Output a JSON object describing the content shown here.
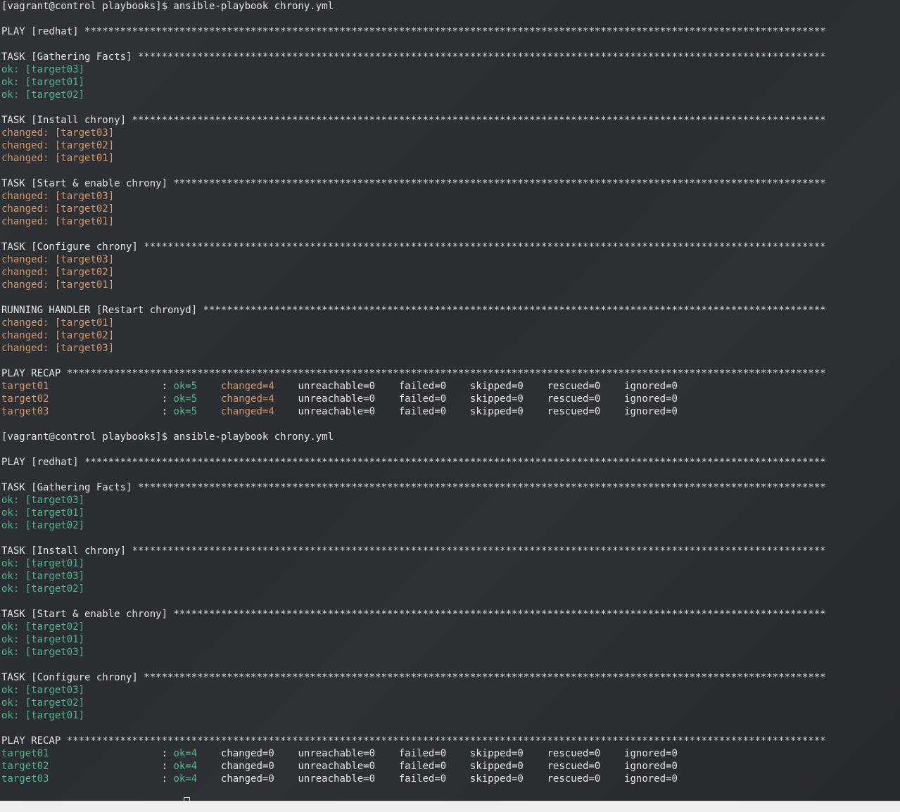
{
  "colors": {
    "background": "#2b2f33",
    "text": "#e4e6e8",
    "ok": "#53b88b",
    "changed": "#d6986b",
    "statusbar": "#efefef"
  },
  "terminal": {
    "lines": [
      [
        {
          "t": "[vagrant@control playbooks]$ ansible-playbook chrony.yml",
          "c": "default"
        }
      ],
      [],
      [
        {
          "t": "PLAY [redhat] ",
          "c": "default"
        },
        {
          "t": "*****************************************************************************************************************************",
          "c": "stars"
        }
      ],
      [],
      [
        {
          "t": "TASK [Gathering Facts] ",
          "c": "default"
        },
        {
          "t": "********************************************************************************************************************",
          "c": "stars"
        }
      ],
      [
        {
          "t": "ok: [target03]",
          "c": "ok"
        }
      ],
      [
        {
          "t": "ok: [target01]",
          "c": "ok"
        }
      ],
      [
        {
          "t": "ok: [target02]",
          "c": "ok"
        }
      ],
      [],
      [
        {
          "t": "TASK [Install chrony] ",
          "c": "default"
        },
        {
          "t": "*********************************************************************************************************************",
          "c": "stars"
        }
      ],
      [
        {
          "t": "changed: [target03]",
          "c": "changed"
        }
      ],
      [
        {
          "t": "changed: [target02]",
          "c": "changed"
        }
      ],
      [
        {
          "t": "changed: [target01]",
          "c": "changed"
        }
      ],
      [],
      [
        {
          "t": "TASK [Start & enable chrony] ",
          "c": "default"
        },
        {
          "t": "**************************************************************************************************************",
          "c": "stars"
        }
      ],
      [
        {
          "t": "changed: [target03]",
          "c": "changed"
        }
      ],
      [
        {
          "t": "changed: [target02]",
          "c": "changed"
        }
      ],
      [
        {
          "t": "changed: [target01]",
          "c": "changed"
        }
      ],
      [],
      [
        {
          "t": "TASK [Configure chrony] ",
          "c": "default"
        },
        {
          "t": "*******************************************************************************************************************",
          "c": "stars"
        }
      ],
      [
        {
          "t": "changed: [target03]",
          "c": "changed"
        }
      ],
      [
        {
          "t": "changed: [target02]",
          "c": "changed"
        }
      ],
      [
        {
          "t": "changed: [target01]",
          "c": "changed"
        }
      ],
      [],
      [
        {
          "t": "RUNNING HANDLER [Restart chronyd] ",
          "c": "default"
        },
        {
          "t": "*********************************************************************************************************",
          "c": "stars"
        }
      ],
      [
        {
          "t": "changed: [target01]",
          "c": "changed"
        }
      ],
      [
        {
          "t": "changed: [target02]",
          "c": "changed"
        }
      ],
      [
        {
          "t": "changed: [target03]",
          "c": "changed"
        }
      ],
      [],
      [
        {
          "t": "PLAY RECAP ",
          "c": "default"
        },
        {
          "t": "********************************************************************************************************************************",
          "c": "stars"
        }
      ],
      [
        {
          "t": "target01",
          "c": "changed"
        },
        {
          "t": "                   : ",
          "c": "default"
        },
        {
          "t": "ok=5",
          "c": "ok"
        },
        {
          "t": "    ",
          "c": "default"
        },
        {
          "t": "changed=4",
          "c": "changed"
        },
        {
          "t": "    unreachable=0    failed=0    skipped=0    rescued=0    ignored=0",
          "c": "default"
        }
      ],
      [
        {
          "t": "target02",
          "c": "changed"
        },
        {
          "t": "                   : ",
          "c": "default"
        },
        {
          "t": "ok=5",
          "c": "ok"
        },
        {
          "t": "    ",
          "c": "default"
        },
        {
          "t": "changed=4",
          "c": "changed"
        },
        {
          "t": "    unreachable=0    failed=0    skipped=0    rescued=0    ignored=0",
          "c": "default"
        }
      ],
      [
        {
          "t": "target03",
          "c": "changed"
        },
        {
          "t": "                   : ",
          "c": "default"
        },
        {
          "t": "ok=5",
          "c": "ok"
        },
        {
          "t": "    ",
          "c": "default"
        },
        {
          "t": "changed=4",
          "c": "changed"
        },
        {
          "t": "    unreachable=0    failed=0    skipped=0    rescued=0    ignored=0",
          "c": "default"
        }
      ],
      [],
      [
        {
          "t": "[vagrant@control playbooks]$ ansible-playbook chrony.yml",
          "c": "default"
        }
      ],
      [],
      [
        {
          "t": "PLAY [redhat] ",
          "c": "default"
        },
        {
          "t": "*****************************************************************************************************************************",
          "c": "stars"
        }
      ],
      [],
      [
        {
          "t": "TASK [Gathering Facts] ",
          "c": "default"
        },
        {
          "t": "********************************************************************************************************************",
          "c": "stars"
        }
      ],
      [
        {
          "t": "ok: [target03]",
          "c": "ok"
        }
      ],
      [
        {
          "t": "ok: [target01]",
          "c": "ok"
        }
      ],
      [
        {
          "t": "ok: [target02]",
          "c": "ok"
        }
      ],
      [],
      [
        {
          "t": "TASK [Install chrony] ",
          "c": "default"
        },
        {
          "t": "*********************************************************************************************************************",
          "c": "stars"
        }
      ],
      [
        {
          "t": "ok: [target01]",
          "c": "ok"
        }
      ],
      [
        {
          "t": "ok: [target03]",
          "c": "ok"
        }
      ],
      [
        {
          "t": "ok: [target02]",
          "c": "ok"
        }
      ],
      [],
      [
        {
          "t": "TASK [Start & enable chrony] ",
          "c": "default"
        },
        {
          "t": "**************************************************************************************************************",
          "c": "stars"
        }
      ],
      [
        {
          "t": "ok: [target02]",
          "c": "ok"
        }
      ],
      [
        {
          "t": "ok: [target01]",
          "c": "ok"
        }
      ],
      [
        {
          "t": "ok: [target03]",
          "c": "ok"
        }
      ],
      [],
      [
        {
          "t": "TASK [Configure chrony] ",
          "c": "default"
        },
        {
          "t": "*******************************************************************************************************************",
          "c": "stars"
        }
      ],
      [
        {
          "t": "ok: [target03]",
          "c": "ok"
        }
      ],
      [
        {
          "t": "ok: [target02]",
          "c": "ok"
        }
      ],
      [
        {
          "t": "ok: [target01]",
          "c": "ok"
        }
      ],
      [],
      [
        {
          "t": "PLAY RECAP ",
          "c": "default"
        },
        {
          "t": "********************************************************************************************************************************",
          "c": "stars"
        }
      ],
      [
        {
          "t": "target01",
          "c": "ok"
        },
        {
          "t": "                   : ",
          "c": "default"
        },
        {
          "t": "ok=4",
          "c": "ok"
        },
        {
          "t": "    changed=0    unreachable=0    failed=0    skipped=0    rescued=0    ignored=0",
          "c": "default"
        }
      ],
      [
        {
          "t": "target02",
          "c": "ok"
        },
        {
          "t": "                   : ",
          "c": "default"
        },
        {
          "t": "ok=4",
          "c": "ok"
        },
        {
          "t": "    changed=0    unreachable=0    failed=0    skipped=0    rescued=0    ignored=0",
          "c": "default"
        }
      ],
      [
        {
          "t": "target03",
          "c": "ok"
        },
        {
          "t": "                   : ",
          "c": "default"
        },
        {
          "t": "ok=4",
          "c": "ok"
        },
        {
          "t": "    changed=0    unreachable=0    failed=0    skipped=0    rescued=0    ignored=0",
          "c": "default"
        }
      ]
    ]
  }
}
